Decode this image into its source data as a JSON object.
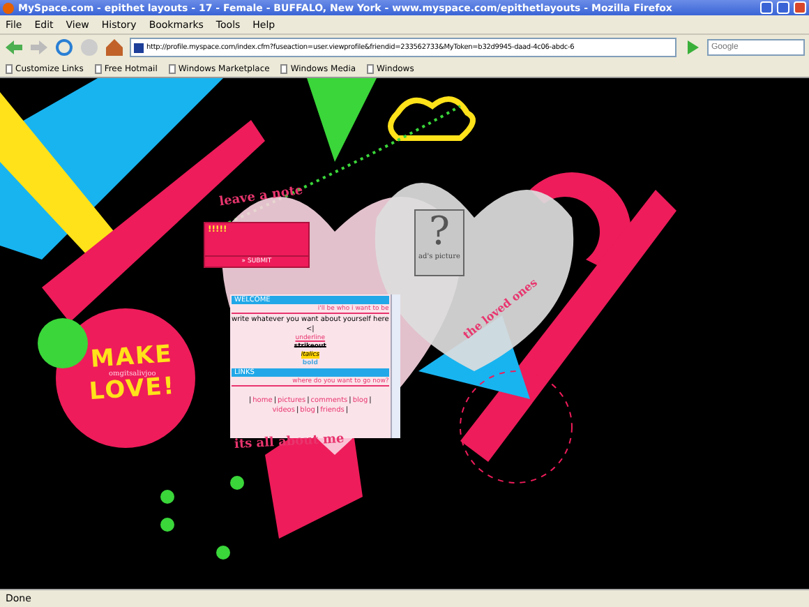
{
  "window": {
    "title": "MySpace.com - epithet layouts - 17 - Female - BUFFALO, New York - www.myspace.com/epithetlayouts - Mozilla Firefox"
  },
  "menu": [
    "File",
    "Edit",
    "View",
    "History",
    "Bookmarks",
    "Tools",
    "Help"
  ],
  "address_bar": {
    "value": "http://profile.myspace.com/index.cfm?fuseaction=user.viewprofile&friendid=233562733&MyToken=b32d9945-daad-4c06-abdc-6"
  },
  "search": {
    "placeholder": "Google"
  },
  "bookmarks": [
    "Customize Links",
    "Free Hotmail",
    "Windows Marketplace",
    "Windows Media",
    "Windows"
  ],
  "page": {
    "note": {
      "heading": "leave a note",
      "value": "!!!!!",
      "submit": "» SUBMIT"
    },
    "picture": {
      "placeholder": "?",
      "caption": "ad's picture",
      "heading": "the loved ones"
    },
    "logo": {
      "lines": [
        "MAKE",
        "LOVE!"
      ],
      "tagline": "omgitsalivjoo"
    },
    "about": {
      "heading": "WELCOME",
      "subheading": "i'll be who i want to be",
      "lines": [
        {
          "kind": "plain",
          "text": "write whatever you want about yourself here"
        },
        {
          "kind": "plain",
          "text": "<|"
        },
        {
          "kind": "underline",
          "text": "underline"
        },
        {
          "kind": "strike",
          "text": "strikeout"
        },
        {
          "kind": "highlight",
          "text": "italics"
        },
        {
          "kind": "bold",
          "text": "bold"
        }
      ],
      "links_heading": "LINKS",
      "links_subheading": "where do you want to go now?",
      "separator": "|",
      "links": [
        "home",
        "pictures",
        "comments",
        "blog",
        "videos",
        "blog",
        "friends"
      ]
    },
    "footer_heading": "its all about me"
  },
  "status_bar": {
    "text": "Done"
  }
}
